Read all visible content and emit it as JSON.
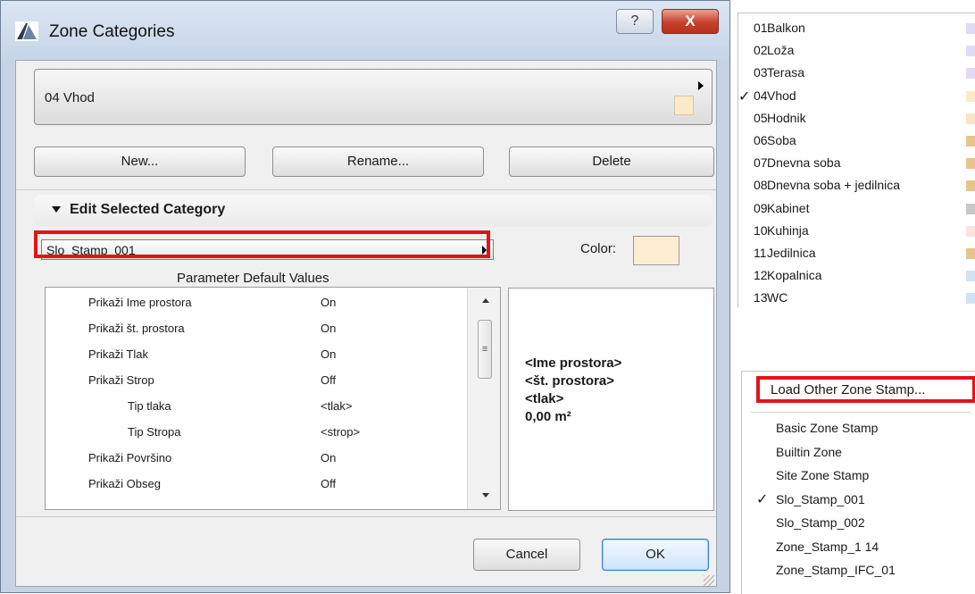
{
  "dialog": {
    "title": "Zone Categories",
    "help_label": "?",
    "close_label": "X",
    "selected_category": "04  Vhod",
    "category_color": "#fdeac8",
    "buttons": {
      "new": "New...",
      "rename": "Rename...",
      "delete": "Delete"
    },
    "section_title": "Edit Selected Category",
    "stamp_value": "Slo_Stamp_001",
    "color_label": "Color:",
    "stamp_color": "#fdeed2",
    "param_header": "Parameter Default Values",
    "params": [
      {
        "name": "Prikaži Ime prostora",
        "value": "On",
        "indent": 0
      },
      {
        "name": "Prikaži št. prostora",
        "value": "On",
        "indent": 0
      },
      {
        "name": "Prikaži Tlak",
        "value": "On",
        "indent": 0
      },
      {
        "name": "Prikaži Strop",
        "value": "Off",
        "indent": 0
      },
      {
        "name": "Tip tlaka",
        "value": "<tlak>",
        "indent": 1
      },
      {
        "name": "Tip Stropa",
        "value": "<strop>",
        "indent": 1
      },
      {
        "name": "Prikaži Površino",
        "value": "On",
        "indent": 0
      },
      {
        "name": "Prikaži Obseg",
        "value": "Off",
        "indent": 0
      }
    ],
    "scrollbar_thumb_glyph": "≡",
    "preview": [
      "<Ime prostora>",
      "<št. prostora>",
      "<tlak>",
      "0,00 m²"
    ],
    "cancel_label": "Cancel",
    "ok_label": "OK"
  },
  "category_menu": {
    "checked_index": 3,
    "check_glyph": "✓",
    "items": [
      {
        "num": "01",
        "name": "Balkon",
        "color": "#e2d9f7"
      },
      {
        "num": "02",
        "name": "Loža",
        "color": "#e2d9f7"
      },
      {
        "num": "03",
        "name": "Terasa",
        "color": "#e2d9f7"
      },
      {
        "num": "04",
        "name": "Vhod",
        "color": "#fdeac8"
      },
      {
        "num": "05",
        "name": "Hodnik",
        "color": "#fbe4c4"
      },
      {
        "num": "06",
        "name": "Soba",
        "color": "#e6c48c"
      },
      {
        "num": "07",
        "name": "Dnevna soba",
        "color": "#e6c48c"
      },
      {
        "num": "08",
        "name": "Dnevna soba + jedilnica",
        "color": "#e6c48c"
      },
      {
        "num": "09",
        "name": "Kabinet",
        "color": "#c8c8c8"
      },
      {
        "num": "10",
        "name": "Kuhinja",
        "color": "#fde2e2"
      },
      {
        "num": "11",
        "name": "Jedilnica",
        "color": "#e6c48c"
      },
      {
        "num": "12",
        "name": "Kopalnica",
        "color": "#cfe3f2"
      },
      {
        "num": "13",
        "name": "WC",
        "color": "#cfe3f2"
      }
    ]
  },
  "stamp_menu": {
    "load_other": "Load Other Zone Stamp...",
    "checked_index": 3,
    "check_glyph": "✓",
    "items": [
      "Basic Zone Stamp",
      "Builtin Zone",
      "Site Zone Stamp",
      "Slo_Stamp_001",
      "Slo_Stamp_002",
      "Zone_Stamp_1 14",
      "Zone_Stamp_IFC_01"
    ]
  },
  "highlight_color": "#e2141a"
}
